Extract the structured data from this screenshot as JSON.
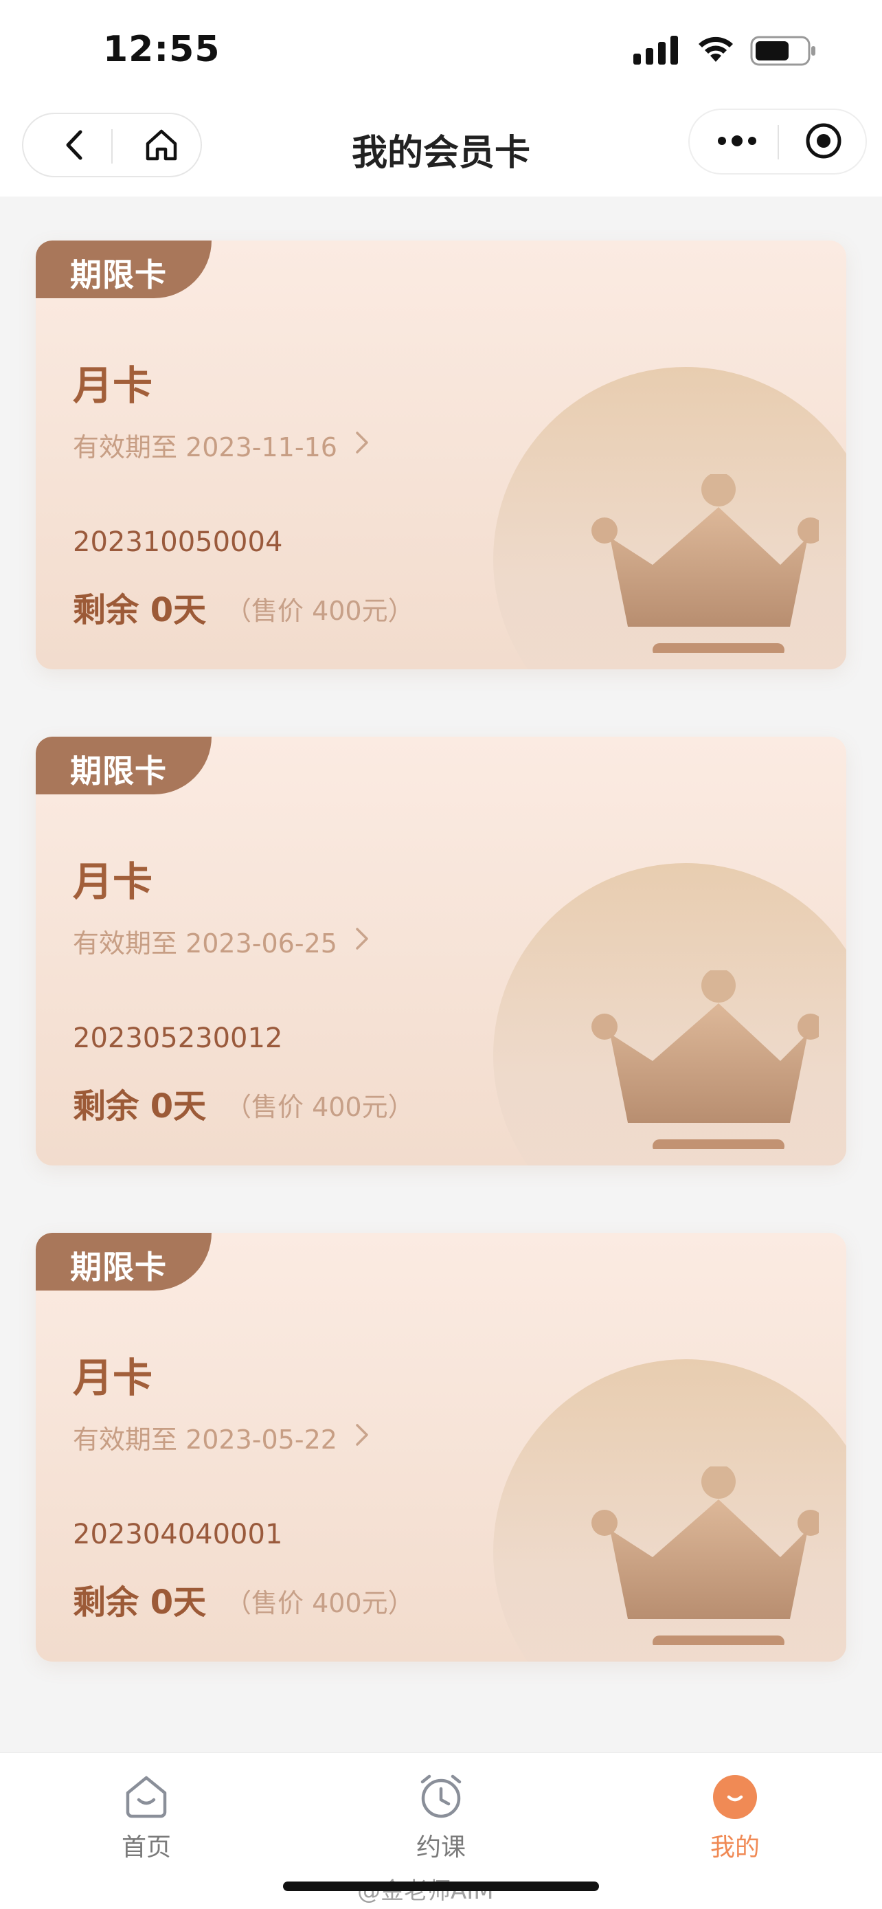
{
  "status_bar": {
    "time": "12:55",
    "icons": [
      "signal-icon",
      "wifi-icon",
      "battery-icon"
    ]
  },
  "nav": {
    "title": "我的会员卡",
    "left_icons": [
      "back-icon",
      "home-icon"
    ],
    "right_icons": [
      "more-icon",
      "close-mini-program-icon"
    ]
  },
  "cards": [
    {
      "tag": "期限卡",
      "name": "月卡",
      "validity": "有效期至 2023-11-16",
      "number": "202310050004",
      "remaining": "剩余 0天",
      "price": "（售价 400元）"
    },
    {
      "tag": "期限卡",
      "name": "月卡",
      "validity": "有效期至 2023-06-25",
      "number": "202305230012",
      "remaining": "剩余 0天",
      "price": "（售价 400元）"
    },
    {
      "tag": "期限卡",
      "name": "月卡",
      "validity": "有效期至 2023-05-22",
      "number": "202304040001",
      "remaining": "剩余 0天",
      "price": "（售价 400元）"
    }
  ],
  "tabs": [
    {
      "label": "首页",
      "icon": "home-tab-icon",
      "active": false
    },
    {
      "label": "约课",
      "icon": "alarm-clock-icon",
      "active": false
    },
    {
      "label": "我的",
      "icon": "profile-icon",
      "active": true
    }
  ],
  "colors": {
    "accent": "#f08a55",
    "card_tag": "#a9775a",
    "card_title": "#a25f3a"
  },
  "watermark": "@金老师AIM"
}
